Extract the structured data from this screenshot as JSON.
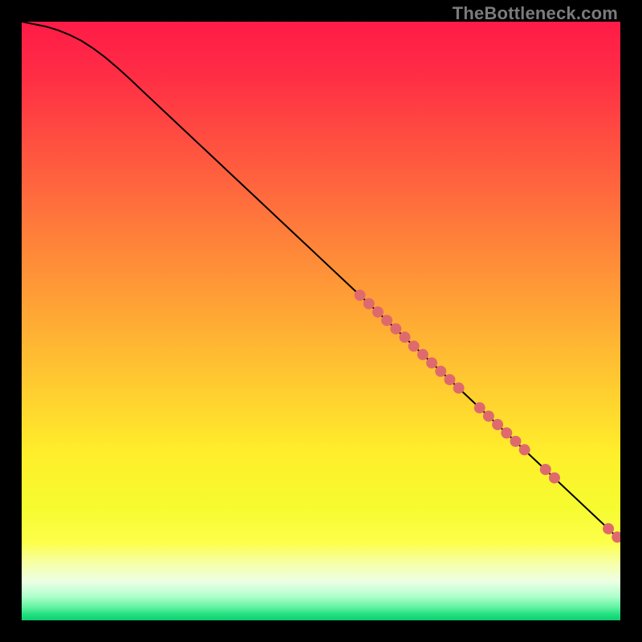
{
  "watermark": "TheBottleneck.com",
  "chart_data": {
    "type": "line",
    "title": "",
    "xlabel": "",
    "ylabel": "",
    "xlim": [
      0,
      100
    ],
    "ylim": [
      0,
      100
    ],
    "background_gradient_stops": [
      {
        "offset": 0.0,
        "color": "#ff1b47"
      },
      {
        "offset": 0.09,
        "color": "#ff2d45"
      },
      {
        "offset": 0.18,
        "color": "#ff4941"
      },
      {
        "offset": 0.27,
        "color": "#ff643e"
      },
      {
        "offset": 0.36,
        "color": "#ff803a"
      },
      {
        "offset": 0.45,
        "color": "#ff9b36"
      },
      {
        "offset": 0.54,
        "color": "#ffb733"
      },
      {
        "offset": 0.63,
        "color": "#ffd22f"
      },
      {
        "offset": 0.72,
        "color": "#ffee2b"
      },
      {
        "offset": 0.81,
        "color": "#f6fb2f"
      },
      {
        "offset": 0.87,
        "color": "#fdff4a"
      },
      {
        "offset": 0.905,
        "color": "#f6ffa8"
      },
      {
        "offset": 0.935,
        "color": "#edffe5"
      },
      {
        "offset": 0.96,
        "color": "#afffcc"
      },
      {
        "offset": 0.978,
        "color": "#63f3a2"
      },
      {
        "offset": 0.99,
        "color": "#22e07f"
      },
      {
        "offset": 1.0,
        "color": "#0fce70"
      }
    ],
    "series": [
      {
        "name": "curve",
        "color": "#000000",
        "width": 2,
        "x": [
          0,
          2,
          4,
          6,
          8,
          10,
          12,
          14,
          16,
          18,
          20,
          25,
          30,
          35,
          40,
          45,
          50,
          55,
          60,
          65,
          70,
          75,
          80,
          85,
          90,
          95,
          100
        ],
        "y": [
          100,
          99.6,
          99.2,
          98.6,
          97.8,
          96.8,
          95.5,
          94.0,
          92.3,
          90.5,
          88.6,
          83.9,
          79.2,
          74.5,
          69.8,
          65.1,
          60.4,
          55.7,
          51.0,
          46.3,
          41.6,
          36.9,
          32.2,
          27.5,
          22.8,
          18.1,
          13.4
        ]
      }
    ],
    "markers": {
      "color": "#df6a6e",
      "radius": 7,
      "points": [
        {
          "x": 56.5,
          "y": 54.3
        },
        {
          "x": 58.0,
          "y": 52.9
        },
        {
          "x": 59.5,
          "y": 51.5
        },
        {
          "x": 61.0,
          "y": 50.1
        },
        {
          "x": 62.5,
          "y": 48.7
        },
        {
          "x": 64.0,
          "y": 47.3
        },
        {
          "x": 65.5,
          "y": 45.8
        },
        {
          "x": 67.0,
          "y": 44.4
        },
        {
          "x": 68.5,
          "y": 43.0
        },
        {
          "x": 70.0,
          "y": 41.6
        },
        {
          "x": 71.5,
          "y": 40.2
        },
        {
          "x": 73.0,
          "y": 38.8
        },
        {
          "x": 76.5,
          "y": 35.5
        },
        {
          "x": 78.0,
          "y": 34.1
        },
        {
          "x": 79.5,
          "y": 32.7
        },
        {
          "x": 81.0,
          "y": 31.3
        },
        {
          "x": 82.5,
          "y": 29.9
        },
        {
          "x": 84.0,
          "y": 28.5
        },
        {
          "x": 87.5,
          "y": 25.2
        },
        {
          "x": 89.0,
          "y": 23.8
        },
        {
          "x": 98.0,
          "y": 15.3
        },
        {
          "x": 99.5,
          "y": 13.9
        }
      ]
    }
  }
}
